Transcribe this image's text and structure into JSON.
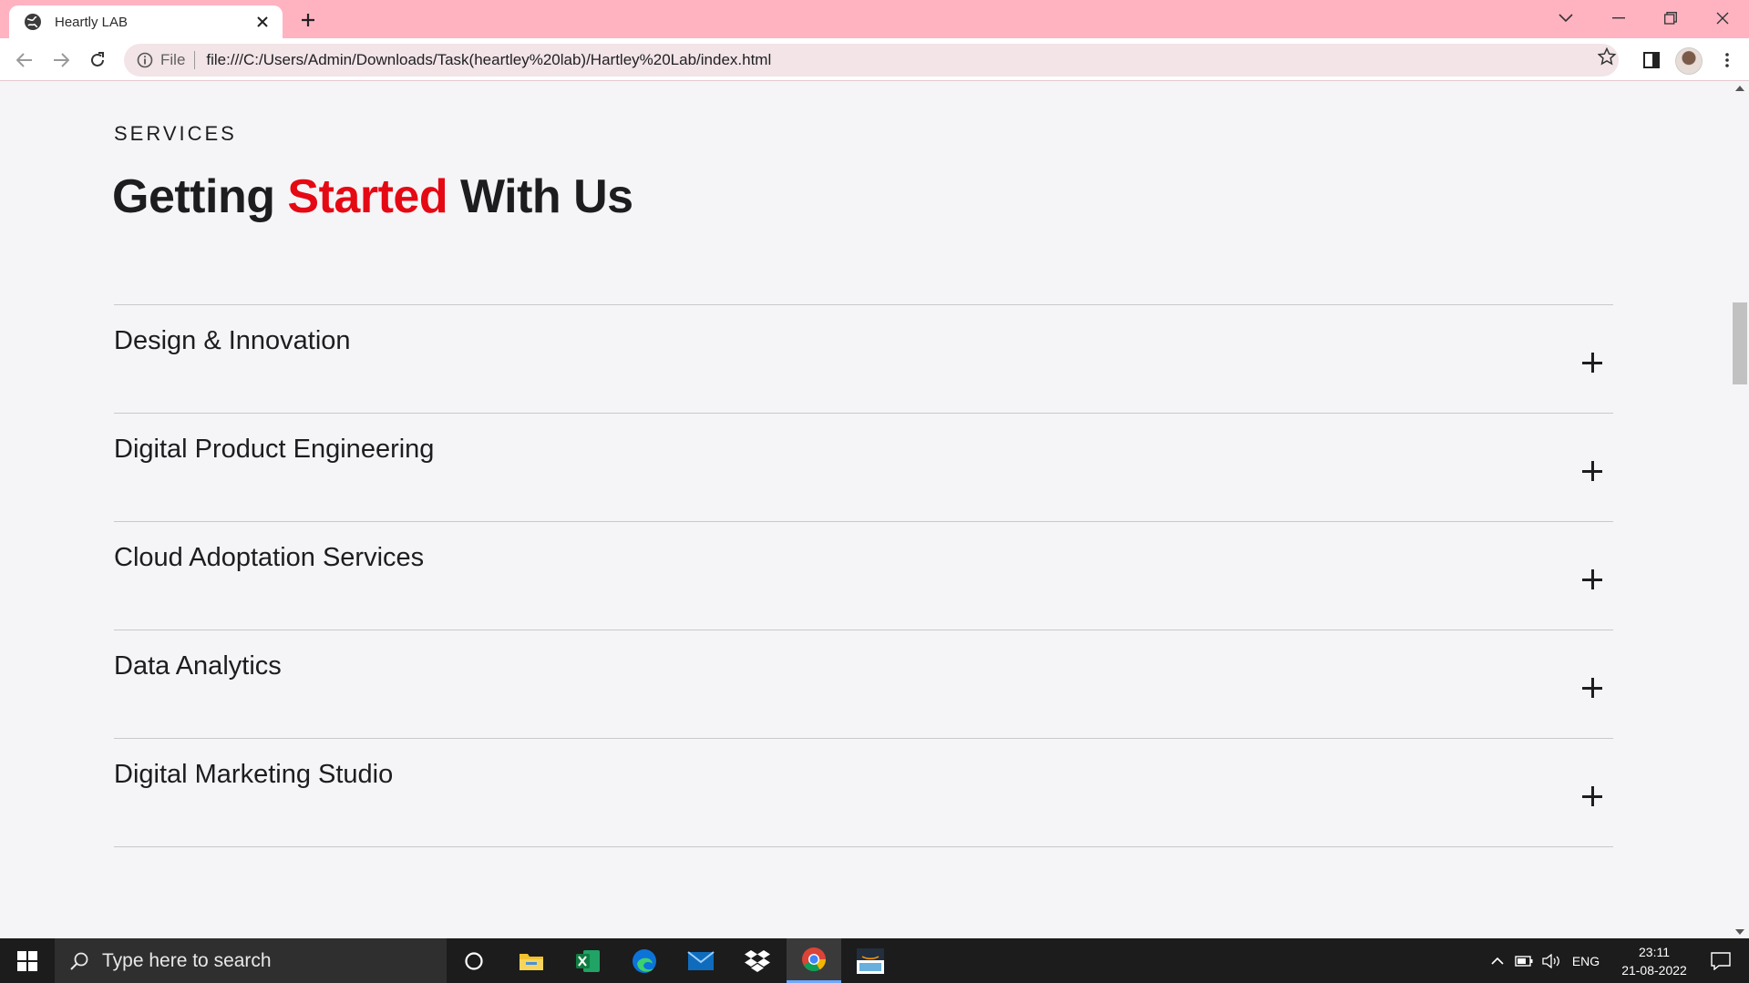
{
  "browser": {
    "tab_title": "Heartly LAB",
    "address_scheme": "File",
    "address_url": "file:///C:/Users/Admin/Downloads/Task(heartley%20lab)/Hartley%20Lab/index.html"
  },
  "page": {
    "eyebrow": "SERVICES",
    "heading_part1": "Getting ",
    "heading_accent": "Started",
    "heading_part2": " With Us",
    "accent_color": "#e50914",
    "services": [
      {
        "label": "Design & Innovation"
      },
      {
        "label": "Digital Product Engineering"
      },
      {
        "label": "Cloud Adoptation Services"
      },
      {
        "label": "Data Analytics"
      },
      {
        "label": "Digital Marketing Studio"
      }
    ]
  },
  "taskbar": {
    "search_placeholder": "Type here to search",
    "language": "ENG",
    "time": "23:11",
    "date": "21-08-2022",
    "apps": [
      "cortana-icon",
      "file-explorer-icon",
      "excel-icon",
      "edge-icon",
      "mail-icon",
      "dropbox-icon",
      "chrome-icon",
      "amazon-icon"
    ]
  }
}
